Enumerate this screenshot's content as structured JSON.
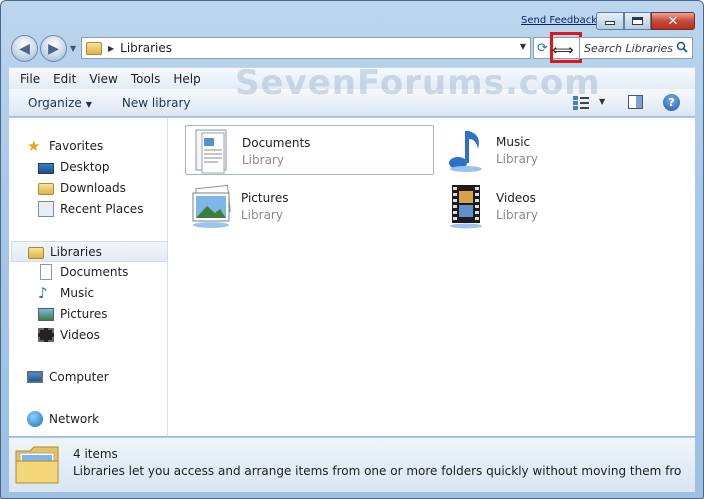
{
  "title_bar": {
    "feedback_link": "Send Feedback"
  },
  "address_bar": {
    "location": "Libraries"
  },
  "search": {
    "placeholder": "Search Libraries"
  },
  "menu": [
    "File",
    "Edit",
    "View",
    "Tools",
    "Help"
  ],
  "commands": {
    "organize": "Organize",
    "new_library": "New library"
  },
  "watermark": "SevenForums.com",
  "nav_pane": {
    "favorites": {
      "label": "Favorites",
      "items": [
        "Desktop",
        "Downloads",
        "Recent Places"
      ]
    },
    "libraries": {
      "label": "Libraries",
      "items": [
        "Documents",
        "Music",
        "Pictures",
        "Videos"
      ]
    },
    "computer": "Computer",
    "network": "Network"
  },
  "libraries": [
    {
      "name": "Documents",
      "type": "Library"
    },
    {
      "name": "Music",
      "type": "Library"
    },
    {
      "name": "Pictures",
      "type": "Library"
    },
    {
      "name": "Videos",
      "type": "Library"
    }
  ],
  "details": {
    "count": "4 items",
    "description": "Libraries let you access and arrange items from one or more folders quickly without moving them from their origi..."
  }
}
